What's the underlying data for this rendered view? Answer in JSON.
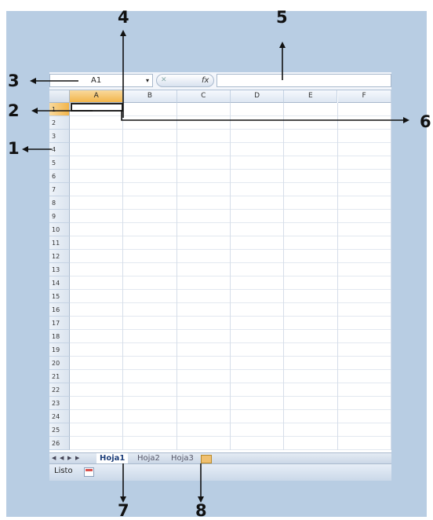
{
  "formula_bar": {
    "name_box_value": "A1",
    "dropdown_glyph": "▾",
    "cancel_glyph": "✕",
    "fx_label": "fx"
  },
  "columns": [
    "A",
    "B",
    "C",
    "D",
    "E",
    "F"
  ],
  "rows": [
    "1",
    "2",
    "3",
    "4",
    "5",
    "6",
    "7",
    "8",
    "9",
    "10",
    "11",
    "12",
    "13",
    "14",
    "15",
    "16",
    "17",
    "18",
    "19",
    "20",
    "21",
    "22",
    "23",
    "24",
    "25",
    "26"
  ],
  "sheet_tabs": [
    "Hoja1",
    "Hoja2",
    "Hoja3"
  ],
  "status_text": "Listo",
  "callouts": [
    "1",
    "2",
    "3",
    "4",
    "5",
    "6",
    "7",
    "8"
  ],
  "colors": {
    "background": "#b8cde3",
    "selected_header": "#f2b54b",
    "active_tab_text": "#1c3e7a"
  }
}
